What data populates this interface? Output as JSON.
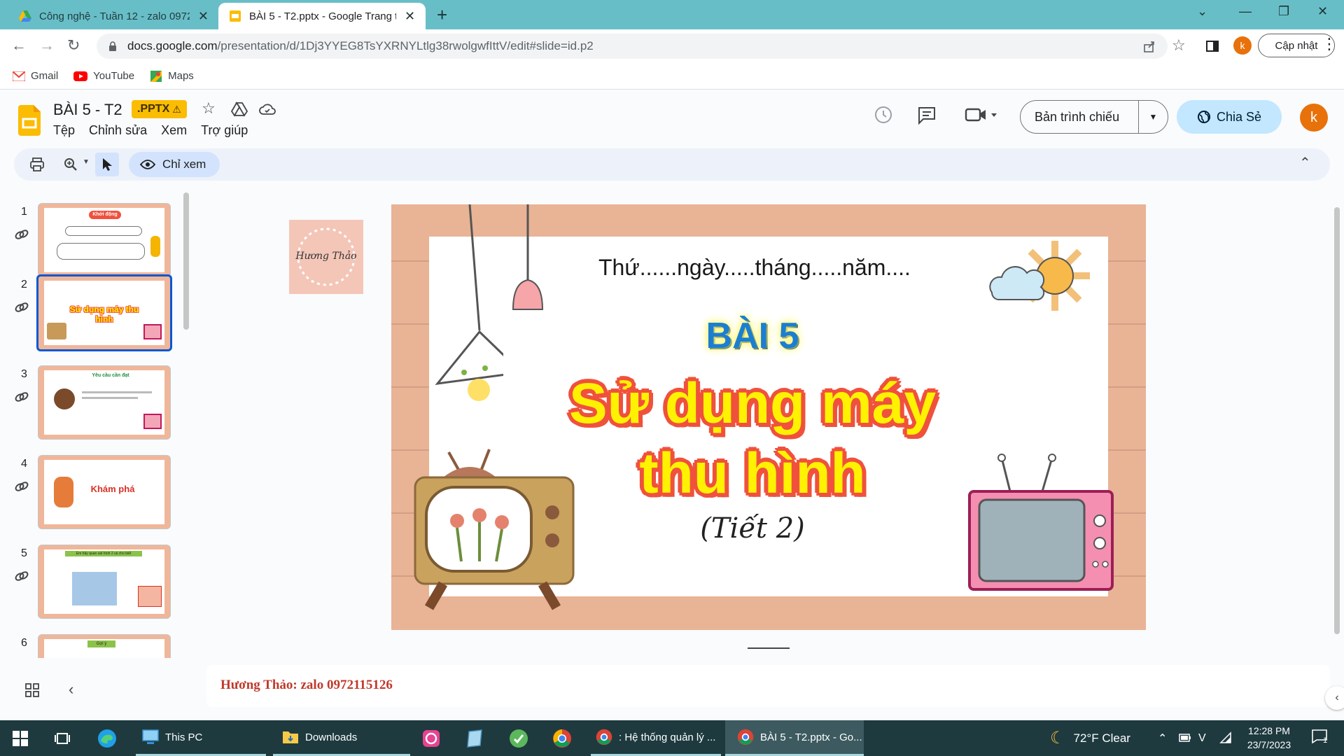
{
  "browser": {
    "tabs": [
      {
        "title": "Công nghệ - Tuần 12 - zalo 0972115126",
        "active": false
      },
      {
        "title": "BÀI 5 - T2.pptx - Google Trang trình bày",
        "active": true
      }
    ],
    "url_host": "docs.google.com",
    "url_path": "/presentation/d/1Dj3YYEG8TsYXRNYLtlg38rwolgwfIttV/edit#slide=id.p2",
    "update_label": "Cập nhật",
    "profile_initial": "k",
    "bookmarks": [
      {
        "label": "Gmail",
        "icon": "gmail-icon"
      },
      {
        "label": "YouTube",
        "icon": "youtube-icon"
      },
      {
        "label": "Maps",
        "icon": "maps-icon"
      }
    ]
  },
  "doc": {
    "title": "BÀI 5 - T2",
    "badge": ".PPTX",
    "menu": [
      "Tệp",
      "Chỉnh sửa",
      "Xem",
      "Trợ giúp"
    ],
    "present_label": "Bản trình chiếu",
    "share_label": "Chia Sẻ",
    "avatar_initial": "k",
    "view_only_label": "Chỉ xem"
  },
  "filmstrip": {
    "slides": [
      {
        "number": "1",
        "caption": "Khởi động"
      },
      {
        "number": "2",
        "caption": "Sử dụng máy thu hình"
      },
      {
        "number": "3",
        "caption": "Yêu cầu cần đạt"
      },
      {
        "number": "4",
        "caption": "Khám phá"
      },
      {
        "number": "5",
        "caption": "Em hãy quan sát hình 2 và cho biết"
      },
      {
        "number": "6",
        "caption": "Gợi ý"
      }
    ],
    "selected_index": 1
  },
  "slide": {
    "date_line": "Thứ......ngày.....tháng.....năm....",
    "lesson": "BÀI 5",
    "title_line1": "Sử dụng máy",
    "title_line2": "thu hình",
    "subtitle": "(Tiết 2)",
    "watermark": "Hương Thảo"
  },
  "notes": {
    "text": "Hương Thảo: zalo 0972115126"
  },
  "taskbar": {
    "items": [
      {
        "label": "This PC"
      },
      {
        "label": "Downloads"
      },
      {
        "label": ": Hệ thống quản lý ..."
      },
      {
        "label": "BÀI 5 - T2.pptx - Go..."
      }
    ],
    "weather": "72°F  Clear",
    "time": "12:28 PM",
    "date": "23/7/2023",
    "notification_count": "1"
  },
  "colors": {
    "tabbar": "#68bec7",
    "slides_yellow": "#fbbc04",
    "share_blue": "#c2e7ff",
    "slide_wood": "#e9b396",
    "title_yellow": "#fff200",
    "title_red": "#f0513d",
    "lesson_blue": "#1b7ed1",
    "notes_red": "#c0392b",
    "taskbar": "#1e3a3f"
  }
}
